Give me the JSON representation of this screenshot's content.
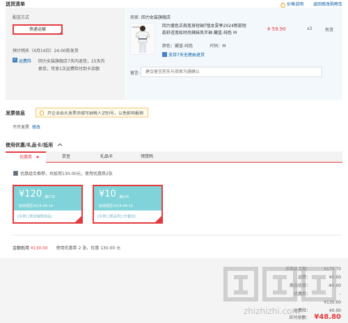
{
  "header": {
    "title": "送货清单",
    "price_info_link": "价格说明",
    "back_to_cart_link": "返回修改购物车"
  },
  "shipping": {
    "method_label": "配送方式",
    "method_selected": "快递运输",
    "deliver_time": "预计明天（4月14日）24:00前发货",
    "service_label": "运费险",
    "service_text": "回力女装旗舰店7天内退货，15天内换货，可享1次运费险付到卡余额"
  },
  "seller": {
    "label": "商家:",
    "name": "回力女装旗舰店"
  },
  "product": {
    "name": "回力撞色正肩宽身短袖T恤女夏季2024新款短款舒适宽松时尚辣妹风半袖 藏蓝-纯色 M",
    "price": "¥ 59.90",
    "qty": "x3",
    "stock": "有货",
    "color_label": "颜色：",
    "color_value": "藏蓝-纯色",
    "size_label": "尺码：",
    "size_value": "M",
    "return_tag": "支持7天无理由退货"
  },
  "remark": {
    "label": "留言:",
    "placeholder": "建议留言前先与商家沟通确认"
  },
  "invoice": {
    "title": "发票信息",
    "tip": "开企业抬头发票须填写纳税人识别号，以免影响报销",
    "status": "不开发票",
    "edit_link": "修改"
  },
  "coupons": {
    "section_title": "使用优惠/礼品卡/抵用",
    "tabs": [
      "优惠券",
      "京豆",
      "礼品卡",
      "领货码"
    ],
    "recommend_text": "优惠组合推荐，共抵用130.00元，使用优惠券2张",
    "items": [
      {
        "amount": "¥120",
        "condition": "满179",
        "date": "有效期至2024-04-14",
        "footer": "[东券]  [限店铺限商品]"
      },
      {
        "amount": "¥10",
        "condition": "满100",
        "date": "有效期至2024-04-15",
        "footer": "[东券]  [限品类]  [可叠加]"
      }
    ],
    "summary_label": "金额抵用",
    "summary_amount": "¥130.00",
    "summary_detail": "使用优惠券 2 张，优惠 130.00 元"
  },
  "totals": {
    "rows": [
      {
        "label": "总商品金额：",
        "value": "¥179.70"
      },
      {
        "label": "运费：",
        "value": "¥0.00"
      },
      {
        "label": "商品优惠：",
        "value": "-¥0.00"
      },
      {
        "label": "优惠券：",
        "value": "-¥130.00"
      },
      {
        "label": "运费险：",
        "value": "¥0.00"
      }
    ],
    "pay_label": "应付总额：",
    "pay_amount": "¥48.80"
  },
  "watermark": "zhizhizhi.com"
}
